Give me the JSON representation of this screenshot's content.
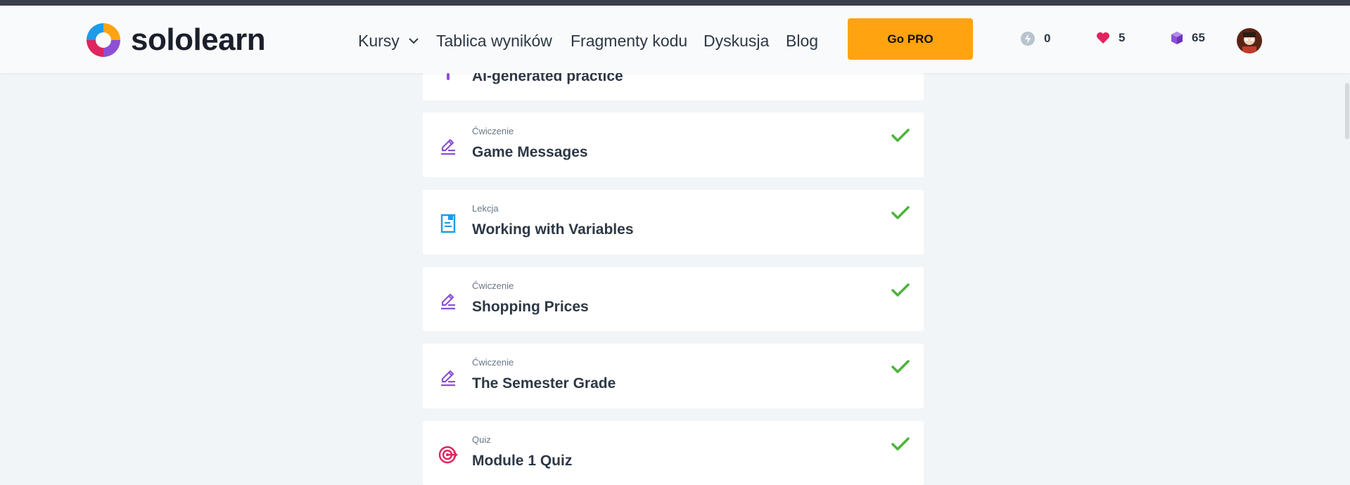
{
  "header": {
    "logo_text": "sololearn",
    "nav": {
      "courses": "Kursy",
      "leaderboard": "Tablica wyników",
      "code_snippets": "Fragmenty kodu",
      "discussion": "Dyskusja",
      "blog": "Blog"
    },
    "go_pro": "Go PRO",
    "stats": {
      "streak": "0",
      "hearts": "5",
      "gems": "65"
    }
  },
  "items": [
    {
      "type": "",
      "title": "AI-generated practice",
      "icon": "ai-practice-icon",
      "completed": false
    },
    {
      "type": "Ćwiczenie",
      "title": "Game Messages",
      "icon": "pencil-icon",
      "completed": true
    },
    {
      "type": "Lekcja",
      "title": "Working with Variables",
      "icon": "lesson-document-icon",
      "completed": true
    },
    {
      "type": "Ćwiczenie",
      "title": "Shopping Prices",
      "icon": "pencil-icon",
      "completed": true
    },
    {
      "type": "Ćwiczenie",
      "title": "The Semester Grade",
      "icon": "pencil-icon",
      "completed": true
    },
    {
      "type": "Quiz",
      "title": "Module 1 Quiz",
      "icon": "quiz-target-icon",
      "completed": true
    }
  ],
  "colors": {
    "accent_orange": "#ffa310",
    "check_green": "#4cb33a",
    "exercise_purple": "#8c4fd6",
    "lesson_blue": "#1e9be6",
    "quiz_pink": "#e0245e"
  }
}
